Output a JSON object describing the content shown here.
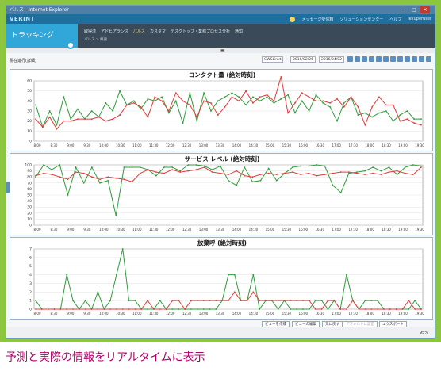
{
  "window": {
    "title": "パルス - Internet Explorer",
    "min": "–",
    "max": "□",
    "close": "✕"
  },
  "app": {
    "brand": "VERINT",
    "header_links": [
      "メッセージ受信箱",
      "ソリューションセンター",
      "ヘルプ"
    ],
    "user": "lexuperuser"
  },
  "nav": {
    "tracking": "トラッキング",
    "tabs": [
      "取得済",
      "アドヒアランス",
      "パルス",
      "カスタマ",
      "デスクトップ・業務プロセス分析",
      "通知"
    ],
    "active_tab_index": 2,
    "breadcrumb": "パルス > 概要"
  },
  "toolbar": {
    "view_title": "現在進行(詳細)",
    "period_select": "CWSLinkt",
    "date_from": "2016/02/26",
    "date_to": "2016/04/02"
  },
  "buttons": {
    "create_view": "ビューを作成",
    "edit_view": "ビューの編集",
    "reset": "元に戻す",
    "save_default": "デフォルトに設定",
    "export": "エクスポート"
  },
  "status": {
    "zoom": "95%"
  },
  "caption": "予測と実際の情報をリアルタイムに表示",
  "colors": {
    "forecast": "#2e9b3a",
    "actual": "#e03b3b"
  },
  "chart_data": [
    {
      "type": "line",
      "title": "コンタクト量 (絶対時刻)",
      "categories": [
        "8:00",
        "8:30",
        "9:00",
        "9:30",
        "10:00",
        "10:30",
        "11:00",
        "11:30",
        "12:00",
        "12:30",
        "13:00",
        "13:30",
        "14:00",
        "14:30",
        "15:00",
        "15:30",
        "16:00",
        "16:30",
        "17:00",
        "17:30",
        "18:00",
        "18:30",
        "19:00",
        "19:30"
      ],
      "ylim": [
        0,
        60
      ],
      "yticks": [
        0,
        10,
        20,
        30,
        40,
        50,
        60
      ],
      "series": [
        {
          "color": "#2e9b3a",
          "values": [
            36,
            14,
            30,
            16,
            44,
            22,
            32,
            22,
            30,
            24,
            38,
            30,
            50,
            36,
            40,
            32,
            42,
            40,
            44,
            28,
            40,
            18,
            48,
            20,
            48,
            30,
            40,
            44,
            48,
            44,
            36,
            44,
            40,
            44,
            38,
            42,
            46,
            28,
            40,
            30,
            46,
            38,
            34,
            20,
            38,
            44,
            26,
            28,
            24,
            28,
            30,
            20,
            26,
            30,
            22,
            22
          ]
        },
        {
          "color": "#e03b3b",
          "values": [
            22,
            14,
            24,
            12,
            20,
            20,
            22,
            22,
            22,
            24,
            20,
            22,
            26,
            36,
            38,
            34,
            24,
            44,
            40,
            30,
            48,
            40,
            36,
            24,
            40,
            38,
            26,
            34,
            44,
            40,
            50,
            38,
            44,
            46,
            40,
            64,
            28,
            38,
            48,
            44,
            40,
            40,
            38,
            42,
            34,
            44,
            34,
            16,
            34,
            44,
            36,
            36,
            20,
            22,
            18,
            16
          ]
        }
      ]
    },
    {
      "type": "line",
      "title": "サービス レベル (絶対時刻)",
      "categories": [
        "8:00",
        "8:30",
        "9:00",
        "9:30",
        "10:00",
        "10:30",
        "11:00",
        "11:30",
        "12:00",
        "12:30",
        "13:00",
        "13:30",
        "14:00",
        "14:30",
        "15:00",
        "15:30",
        "16:00",
        "16:30",
        "17:00",
        "17:30",
        "18:00",
        "18:30",
        "19:00",
        "19:30"
      ],
      "ylim": [
        0,
        100
      ],
      "yticks": [
        0,
        10,
        20,
        30,
        40,
        50,
        60,
        70,
        80,
        90,
        100
      ],
      "series": [
        {
          "color": "#2e9b3a",
          "values": [
            80,
            100,
            92,
            100,
            50,
            96,
            70,
            96,
            70,
            74,
            16,
            96,
            96,
            96,
            92,
            82,
            96,
            96,
            90,
            100,
            100,
            98,
            92,
            98,
            74,
            66,
            96,
            72,
            74,
            94,
            74,
            86,
            96,
            98,
            98,
            100,
            98,
            66,
            54,
            86,
            88,
            90,
            96,
            90,
            96,
            84,
            96,
            100,
            98
          ]
        },
        {
          "color": "#e03b3b",
          "values": [
            82,
            86,
            84,
            80,
            76,
            88,
            86,
            80,
            76,
            80,
            78,
            76,
            72,
            86,
            92,
            88,
            86,
            92,
            88,
            90,
            92,
            96,
            88,
            86,
            84,
            90,
            82,
            80,
            84,
            86,
            84,
            86,
            88,
            84,
            86,
            82,
            84,
            86,
            88,
            88,
            86,
            84,
            86,
            84,
            88,
            90,
            86,
            84,
            96
          ]
        }
      ]
    },
    {
      "type": "line",
      "title": "放棄呼 (絶対時刻)",
      "categories": [
        "8:00",
        "8:30",
        "9:00",
        "9:30",
        "10:00",
        "10:30",
        "11:00",
        "11:30",
        "12:00",
        "12:30",
        "13:00",
        "13:30",
        "14:00",
        "14:30",
        "15:00",
        "15:30",
        "16:00",
        "16:30",
        "17:00",
        "17:30",
        "18:00",
        "18:30",
        "19:00",
        "19:30"
      ],
      "ylim": [
        0,
        7
      ],
      "yticks": [
        0,
        1,
        2,
        3,
        4,
        5,
        6,
        7
      ],
      "series": [
        {
          "color": "#2e9b3a",
          "values": [
            1,
            0,
            0,
            0,
            0,
            4,
            1,
            0,
            1,
            0,
            2,
            0,
            1,
            4,
            7,
            1,
            1,
            0,
            0,
            0,
            1,
            0,
            0,
            0,
            0,
            0,
            0,
            0,
            0,
            0,
            1,
            4,
            4,
            1,
            1,
            4,
            0,
            1,
            1,
            0,
            1,
            0,
            0,
            0,
            0,
            1,
            1,
            0,
            1,
            0,
            4,
            1,
            0,
            1,
            1,
            1,
            0,
            0,
            0,
            0,
            0,
            1,
            0
          ]
        },
        {
          "color": "#e03b3b",
          "values": [
            0,
            0,
            0,
            0,
            0,
            0,
            0,
            0,
            0,
            0,
            0,
            0,
            0,
            0,
            0,
            0,
            0,
            0,
            1,
            0,
            0,
            0,
            1,
            1,
            0,
            1,
            1,
            1,
            1,
            1,
            1,
            1,
            2,
            1,
            1,
            2,
            1,
            1,
            1,
            1,
            1,
            1,
            1,
            1,
            1,
            0,
            0,
            1,
            1,
            0,
            0,
            1,
            0,
            0,
            0,
            0,
            0,
            0,
            0,
            0,
            1,
            0,
            0
          ]
        }
      ]
    }
  ]
}
